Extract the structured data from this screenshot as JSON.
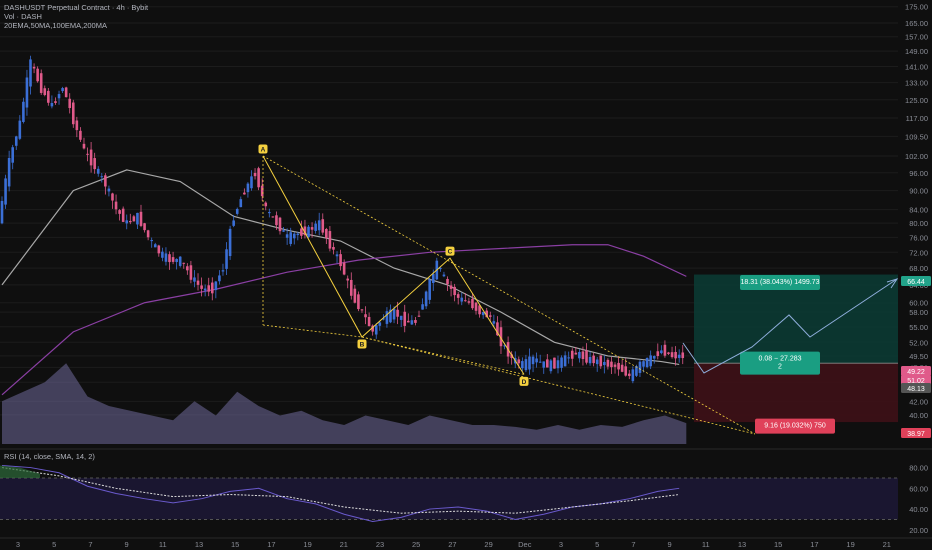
{
  "header": {
    "symbol_line": "DASHUSDT Perpetual Contract · 4h · Bybit",
    "volume_line": "Vol · DASH",
    "ma_line": "20EMA,50MA,100EMA,200MA"
  },
  "rsi_panel": {
    "label": "RSI (14, close, SMA, 14, 2)"
  },
  "colors": {
    "background": "#0f0f0f",
    "bull_candle": "#3b6fd6",
    "bear_candle": "#e05a8a",
    "ma_gray": "#a8a8a8",
    "ma_purple": "#8a3fa3",
    "pattern_yellow": "#f4d03f",
    "target_zone": "#0b3a33",
    "stop_zone": "#3e1117",
    "rsi_line": "#6a5acd"
  },
  "chart_data": {
    "type": "candlestick",
    "y_axis": {
      "scale": "log",
      "ylim": [
        36,
        178
      ],
      "ticks": [
        "175.00",
        "165.00",
        "157.00",
        "149.00",
        "141.00",
        "133.00",
        "125.00",
        "117.00",
        "109.50",
        "102.00",
        "96.00",
        "90.00",
        "84.00",
        "80.00",
        "76.00",
        "72.00",
        "68.00",
        "64.00",
        "60.00",
        "58.00",
        "55.00",
        "52.00",
        "49.50",
        "47.50",
        "45.00",
        "42.00",
        "40.00"
      ]
    },
    "x_axis": {
      "ticks": [
        "3",
        "5",
        "7",
        "9",
        "11",
        "13",
        "15",
        "17",
        "19",
        "21",
        "23",
        "25",
        "27",
        "29",
        "Dec",
        "3",
        "5",
        "7",
        "9",
        "11",
        "13",
        "15",
        "17",
        "19",
        "21"
      ]
    },
    "price_series": [
      [
        0,
        80
      ],
      [
        3,
        100
      ],
      [
        6,
        115
      ],
      [
        9,
        143
      ],
      [
        12,
        130
      ],
      [
        15,
        122
      ],
      [
        18,
        131
      ],
      [
        21,
        116
      ],
      [
        24,
        104
      ],
      [
        27,
        98
      ],
      [
        30,
        92
      ],
      [
        33,
        84
      ],
      [
        36,
        80
      ],
      [
        39,
        82
      ],
      [
        42,
        76
      ],
      [
        45,
        72
      ],
      [
        48,
        70
      ],
      [
        51,
        70
      ],
      [
        54,
        66
      ],
      [
        57,
        63
      ],
      [
        60,
        63
      ],
      [
        63,
        68
      ],
      [
        66,
        82
      ],
      [
        69,
        90
      ],
      [
        72,
        96
      ],
      [
        75,
        84
      ],
      [
        78,
        80
      ],
      [
        81,
        76
      ],
      [
        84,
        77
      ],
      [
        87,
        78
      ],
      [
        90,
        80
      ],
      [
        93,
        74
      ],
      [
        96,
        69
      ],
      [
        99,
        62
      ],
      [
        102,
        58
      ],
      [
        105,
        54
      ],
      [
        108,
        57
      ],
      [
        111,
        58
      ],
      [
        114,
        56
      ],
      [
        117,
        56
      ],
      [
        120,
        62
      ],
      [
        123,
        69
      ],
      [
        126,
        64
      ],
      [
        129,
        61
      ],
      [
        132,
        60
      ],
      [
        135,
        58
      ],
      [
        138,
        57
      ],
      [
        141,
        52
      ],
      [
        144,
        49
      ],
      [
        147,
        48
      ],
      [
        150,
        49
      ],
      [
        153,
        48
      ],
      [
        156,
        48
      ],
      [
        159,
        49
      ],
      [
        162,
        50
      ],
      [
        165,
        49
      ],
      [
        168,
        48.5
      ],
      [
        171,
        48
      ],
      [
        174,
        47.5
      ],
      [
        177,
        46
      ],
      [
        180,
        48
      ],
      [
        183,
        49
      ],
      [
        186,
        50.5
      ],
      [
        189,
        49.5
      ],
      [
        192,
        49.5
      ]
    ],
    "volume_series": [
      [
        0,
        0.45
      ],
      [
        6,
        0.55
      ],
      [
        12,
        0.65
      ],
      [
        18,
        0.85
      ],
      [
        24,
        0.5
      ],
      [
        30,
        0.4
      ],
      [
        36,
        0.35
      ],
      [
        42,
        0.3
      ],
      [
        48,
        0.25
      ],
      [
        54,
        0.45
      ],
      [
        60,
        0.3
      ],
      [
        66,
        0.55
      ],
      [
        72,
        0.4
      ],
      [
        78,
        0.3
      ],
      [
        84,
        0.35
      ],
      [
        90,
        0.25
      ],
      [
        96,
        0.2
      ],
      [
        102,
        0.3
      ],
      [
        108,
        0.25
      ],
      [
        114,
        0.2
      ],
      [
        120,
        0.3
      ],
      [
        126,
        0.25
      ],
      [
        132,
        0.2
      ],
      [
        138,
        0.2
      ],
      [
        144,
        0.18
      ],
      [
        150,
        0.15
      ],
      [
        156,
        0.2
      ],
      [
        162,
        0.15
      ],
      [
        168,
        0.2
      ],
      [
        174,
        0.18
      ],
      [
        180,
        0.25
      ],
      [
        186,
        0.3
      ],
      [
        192,
        0.22
      ]
    ],
    "series": [
      {
        "values": [
          [
            0,
            64
          ],
          [
            20,
            90
          ],
          [
            35,
            97
          ],
          [
            50,
            93
          ],
          [
            65,
            82
          ],
          [
            80,
            78
          ],
          [
            95,
            75
          ],
          [
            110,
            68
          ],
          [
            125,
            64
          ],
          [
            140,
            58
          ],
          [
            155,
            52
          ],
          [
            170,
            49.5
          ],
          [
            185,
            48.5
          ],
          [
            190,
            48
          ]
        ]
      },
      {
        "values": [
          [
            0,
            43
          ],
          [
            20,
            54
          ],
          [
            40,
            60
          ],
          [
            60,
            63
          ],
          [
            80,
            67
          ],
          [
            100,
            70
          ],
          [
            120,
            72
          ],
          [
            140,
            73
          ],
          [
            160,
            74
          ],
          [
            170,
            74
          ],
          [
            180,
            71
          ],
          [
            192,
            66
          ]
        ]
      }
    ],
    "pattern": {
      "points": [
        {
          "label": "A",
          "price": 102.0
        },
        {
          "label": "B",
          "price": 53.0
        },
        {
          "label": "C",
          "price": 70.5
        },
        {
          "label": "D",
          "price": 46.3
        }
      ]
    },
    "position": {
      "target_label": "18.31 (38.043%) 1499.73",
      "entry_label": "0.08 − 27.283\n2",
      "stop_label": "9.16 (19.032%) 750",
      "target_price": 66.44,
      "entry_price": 48.22,
      "stop_price": 38.97
    },
    "price_markers": [
      {
        "value": "66.44",
        "color": "#22a38a"
      },
      {
        "value": "49.22",
        "color": "#e05a8a"
      },
      {
        "value": "51.02",
        "color": "#e05a8a"
      },
      {
        "value": "48.13",
        "color": "#555"
      },
      {
        "value": "38.97",
        "color": "#e0415a"
      }
    ],
    "rsi": {
      "ticks": [
        "80.00",
        "60.00",
        "40.00",
        "20.00"
      ],
      "ylim": [
        15,
        95
      ],
      "line": [
        [
          0,
          82
        ],
        [
          8,
          80
        ],
        [
          16,
          75
        ],
        [
          24,
          62
        ],
        [
          32,
          55
        ],
        [
          40,
          50
        ],
        [
          48,
          46
        ],
        [
          56,
          50
        ],
        [
          64,
          57
        ],
        [
          72,
          60
        ],
        [
          80,
          50
        ],
        [
          88,
          45
        ],
        [
          96,
          35
        ],
        [
          104,
          28
        ],
        [
          112,
          32
        ],
        [
          120,
          40
        ],
        [
          128,
          42
        ],
        [
          136,
          38
        ],
        [
          144,
          30
        ],
        [
          152,
          35
        ],
        [
          160,
          42
        ],
        [
          168,
          45
        ],
        [
          176,
          50
        ],
        [
          184,
          57
        ],
        [
          190,
          60
        ]
      ],
      "sma": [
        [
          0,
          80
        ],
        [
          16,
          72
        ],
        [
          32,
          60
        ],
        [
          48,
          52
        ],
        [
          64,
          54
        ],
        [
          80,
          52
        ],
        [
          96,
          42
        ],
        [
          112,
          36
        ],
        [
          128,
          38
        ],
        [
          144,
          36
        ],
        [
          160,
          42
        ],
        [
          176,
          48
        ],
        [
          190,
          54
        ]
      ]
    }
  }
}
